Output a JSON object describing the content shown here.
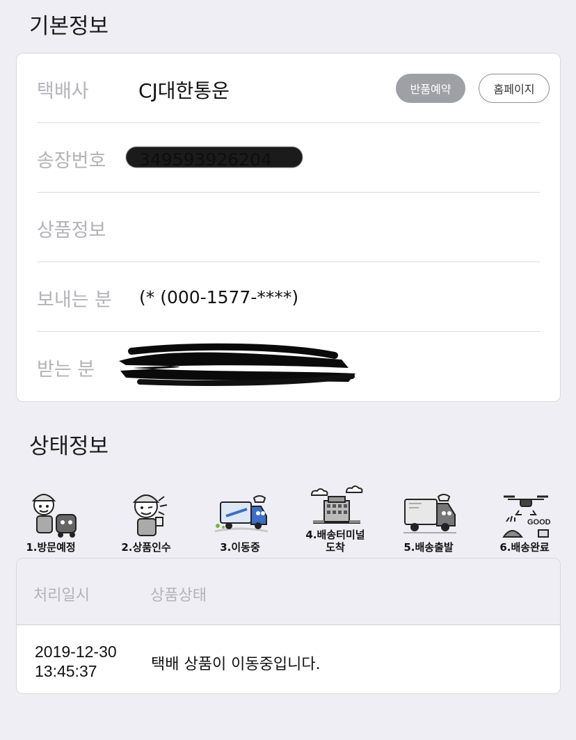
{
  "basic": {
    "title": "기본정보",
    "carrier_label": "택배사",
    "carrier_value": "CJ대한통운",
    "return_button": "반품예약",
    "homepage_button": "홈페이지",
    "tracking_label": "송장번호",
    "tracking_value": "349593926204",
    "product_label": "상품정보",
    "product_value": "",
    "sender_label": "보내는 분",
    "sender_value": "(* (000-1577-****)",
    "receiver_label": "받는 분",
    "receiver_value": ""
  },
  "status": {
    "title": "상태정보",
    "steps": [
      {
        "label": "1.방문예정",
        "icon": "courier-with-cart-icon"
      },
      {
        "label": "2.상품인수",
        "icon": "courier-wink-icon"
      },
      {
        "label": "3.이동중",
        "icon": "truck-moving-icon"
      },
      {
        "label": "4.배송터미널\n도착",
        "icon": "terminal-building-icon"
      },
      {
        "label": "5.배송출발",
        "icon": "truck-departing-icon"
      },
      {
        "label": "6.배송완료",
        "icon": "drone-delivered-icon"
      }
    ],
    "table_headers": {
      "time": "처리일시",
      "state": "상품상태"
    },
    "rows": [
      {
        "date": "2019-12-30",
        "time": "13:45:37",
        "state": "택배 상품이 이동중입니다."
      }
    ]
  },
  "colors": {
    "background": "#efeef4",
    "label_gray": "#b3b2b8",
    "button_filled": "#9fa0a6"
  }
}
